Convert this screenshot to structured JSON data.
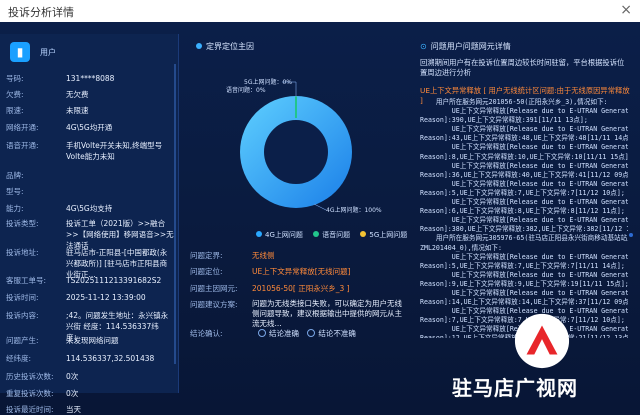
{
  "window": {
    "title": "投诉分析详情",
    "close": "×"
  },
  "user": {
    "label": "用户"
  },
  "fields": [
    {
      "k": "号码:",
      "v": "131****8088"
    },
    {
      "k": "欠费:",
      "v": "无欠费"
    },
    {
      "k": "限速:",
      "v": "未限速"
    },
    {
      "k": "网络开通:",
      "v": "4G\\5G均开通"
    },
    {
      "k": "语音开通:",
      "v": "手机Volte开关未知,终端型号Volte能力未知"
    },
    {
      "k": "品牌:",
      "v": ""
    },
    {
      "k": "型号:",
      "v": ""
    },
    {
      "k": "能力:",
      "v": "4G\\5G均支持"
    },
    {
      "k": "投诉类型:",
      "v": "投诉工单（2021版）>>融合>>【网络使用】移网语音>>无法通话"
    },
    {
      "k": "投诉地址:",
      "v": "驻马店市-正阳县-[中国都政(永兴都政所)] [驻马店市正阳县商业街正..."
    },
    {
      "k": "客服工单号:",
      "v": "TS2025111213391682S2"
    },
    {
      "k": "投诉时间:",
      "v": "2025-11-12 13:39:00"
    },
    {
      "k": "投诉内容:",
      "v": ";42。问题发生地址：永兴镇永兴街 经度：114.536337纬度：..."
    },
    {
      "k": "问题产生:",
      "v": "未发现网络问题"
    },
    {
      "k": "经纬度:",
      "v": "114.536337,32.501438"
    },
    {
      "k": "历史投诉次数:",
      "v": "0次"
    },
    {
      "k": "重复投诉次数:",
      "v": "0次"
    },
    {
      "k": "投诉最近时间:",
      "v": "当天"
    }
  ],
  "center": {
    "title": "定界定位主因",
    "chart_labels": {
      "a": "5G上网问题：0%",
      "b": "语音问题：0%",
      "c": "4G上网问题：100%"
    },
    "legend": [
      "4G上网问题",
      "语音问题",
      "5G上网问题"
    ],
    "rows": [
      {
        "k": "问题定界:",
        "v": "无线侧"
      },
      {
        "k": "问题定位:",
        "v": "UE上下文异常释放[无线问题]"
      },
      {
        "k": "问题主因网元:",
        "v": "201056-50[ 正阳永兴乡_3 ]"
      },
      {
        "k": "问题建议方案:",
        "v": "问题为无线类接口失败，可以确定为用户无线侧问题导致，建议根据输出中提供的网元从主流无线..."
      },
      {
        "k": "结论确认:",
        "v": ""
      }
    ],
    "radio": [
      "结论准确",
      "结论不准确"
    ]
  },
  "right": {
    "title": "问题用户问题网元详情",
    "intro": "回溯期间用户有在投诉位置周边较长时间驻留，平台根据投诉位置周边进行分析",
    "tag": "UE上下文异常释放 [ 用户无线统计区问题:由于无线原因异常释放 ]",
    "log": [
      "    用户所在服务网元201056-50(正阳永兴乡_3),情况如下:",
      "        UE上下文异常释放[Release due to E-UTRAN Generated",
      "Reason]:390,UE上下文异常释放:391[11/11 13点];",
      "        UE上下文异常释放[Release due to E-UTRAN Generated",
      "Reason]:43,UE上下文异常释放:48,UE上下文异常:48[11/11 14点];",
      "        UE上下文异常释放[Release due to E-UTRAN Generated",
      "Reason]:8,UE上下文异常释放:10,UE上下文异常:10[11/11 15点];",
      "        UE上下文异常释放[Release due to E-UTRAN Generated",
      "Reason]:36,UE上下文异常释放:40,UE上下文异常:41[11/12 09点];",
      "        UE上下文异常释放[Release due to E-UTRAN Generated",
      "Reason]:5,UE上下文异常释放:7,UE上下文异常:7[11/12 10点];",
      "        UE上下文异常释放[Release due to E-UTRAN Generated",
      "Reason]:6,UE上下文异常释放:8,UE上下文异常:8[11/12 11点];",
      "        UE上下文异常释放[Release due to E-UTRAN Generated",
      "Reason]:380,UE上下文异常释放:382,UE上下文异常:382[11/12 13点];",
      "    用户所在服务网元305976-65(驻马店正阳县永兴街商移动基站站点",
      "ZML201404_0),情况如下:",
      "        UE上下文异常释放[Release due to E-UTRAN Generated",
      "Reason]:5,UE上下文异常释放:7,UE上下文异常:7[11/11 14点];",
      "        UE上下文异常释放[Release due to E-UTRAN Generated",
      "Reason]:9,UE上下文异常释放:9,UE上下文异常:19[11/11 15点];",
      "        UE上下文异常释放[Release due to E-UTRAN Generated",
      "Reason]:14,UE上下文异常释放:14,UE上下文异常:37[11/12 09点];",
      "        UE上下文异常释放[Release due to E-UTRAN Generated",
      "Reason]:7,UE上下文异常释放:7,UE上下文异常:7[11/12 10点];",
      "        UE上下文异常释放[Release due to E-UTRAN Generated",
      "Reason]:12,UE上下文异常释放:12,UE上下文异常:21[11/12 13点]"
    ]
  },
  "watermark": {
    "text": "驻马店广视网"
  },
  "chart_data": {
    "type": "pie",
    "categories": [
      "4G上网问题",
      "语音问题",
      "5G上网问题"
    ],
    "values": [
      100,
      0,
      0
    ],
    "colors": [
      "#2aa8ff",
      "#22c58c",
      "#f2c233"
    ],
    "legend": "bottom"
  }
}
